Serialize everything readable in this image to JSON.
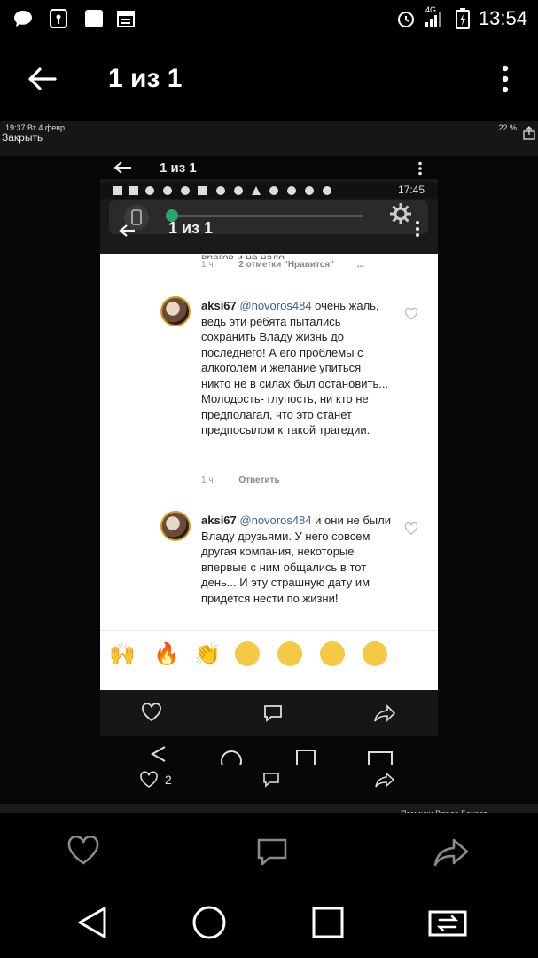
{
  "statusbar": {
    "time": "13:54",
    "network": "4G"
  },
  "appbar": {
    "title": "1 из 1"
  },
  "shot": {
    "ios_time": "19:37  Вт 4 февр.",
    "close_label": "Закрыть",
    "ios_battery": "22 %",
    "inner_title_1": "1 из 1",
    "inner_time": "17:45",
    "inner_title_2": "1 из 1",
    "prev_cut_text": "врагов и не надо.",
    "prev_meta_time": "1 ч.",
    "prev_meta_likes": "2 отметки \"Нравится\"",
    "prev_meta_more": "...",
    "comments": [
      {
        "user": "aksi67",
        "mention": "@novoros484",
        "text": "очень жаль, ведь эти ребята пытались сохранить Владу жизнь до последнего! А его проблемы с алкоголем и желание упиться никто не в силах был остановить... Молодость- глупость, ни кто не предполагал, что это станет предпосылом к такой трагедии.",
        "time": "1 ч.",
        "reply": "Ответить"
      },
      {
        "user": "aksi67",
        "mention": "@novoros484",
        "text": "и они не были Владу друзьями. У него совсем другая компания, некоторые впервые с ним общались в тот день... И эту страшную дату им придется нести по жизни!"
      }
    ],
    "inner_like_count": "2",
    "bottom_cut_text": "Поминки Влада Бахова"
  },
  "icons": {
    "back": "arrow-left-icon",
    "more": "more-vertical-icon",
    "like": "heart-icon",
    "comment": "comment-icon",
    "share": "share-icon",
    "nav_back": "triangle-back-icon",
    "nav_home": "circle-home-icon",
    "nav_recents": "square-recents-icon",
    "nav_switch": "switch-apps-icon"
  },
  "colors": {
    "background": "#000000",
    "content_bg": "#ffffff",
    "mention": "#3a5f8f",
    "avatar_ring": "#d49a2a"
  }
}
